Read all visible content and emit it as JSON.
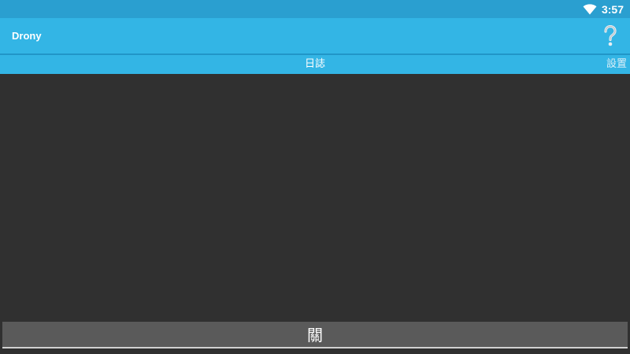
{
  "status_bar": {
    "time": "3:57",
    "wifi_icon": "wifi-icon"
  },
  "app_bar": {
    "title": "Drony",
    "help_icon": "help-icon"
  },
  "tabs": [
    {
      "label": "日誌",
      "active": true
    },
    {
      "label": "設置",
      "active": false
    }
  ],
  "log": {
    "entries": []
  },
  "toggle_button": {
    "label": "關"
  },
  "colors": {
    "status_bar": "#2a9fd0",
    "app_bar": "#33b5e5",
    "background": "#303030",
    "button": "#5a5a5a"
  }
}
